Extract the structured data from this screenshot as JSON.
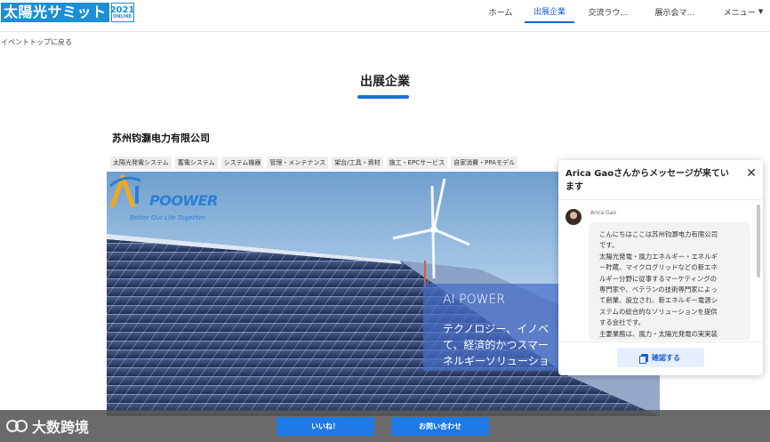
{
  "header": {
    "logo_text": "太陽光サミット",
    "logo_year": "2021",
    "logo_sub": "ONLINE",
    "nav": [
      "ホーム",
      "出展企業",
      "交流ラウ…",
      "展示会マ…"
    ],
    "menu_label": "メニュー"
  },
  "back_link": "イベントトップに戻る",
  "section_title": "出展企業",
  "company": {
    "name": "苏州钧灏电力有限公司",
    "tags": [
      "太陽光発電システム",
      "蓄電システム",
      "システム機器",
      "管理・メンテナンス",
      "架台/工具・資材",
      "施工・EPCサービス",
      "自家消費・PPAモデル"
    ]
  },
  "hero": {
    "brand_mark": "AI",
    "brand_name": "POOWER",
    "slogan": "Better Our Life Together",
    "overlay_title": "AI POWER",
    "overlay_lines": [
      "テクノロジー、イノベ",
      "て、経済的かつスマー",
      "ネルギーソリューショ"
    ]
  },
  "chat": {
    "title": "Arica Gaoさんからメッセージが来ています",
    "sender": "Arica Gao",
    "message_lines": [
      "こんにちはここは苏州钧灏电力有限公司",
      "です。",
      "太陽光発電・風力エネルギー・エネルギ",
      "ー貯蔵、マイクログリッドなどの新エネ",
      "ルギー分野に従事するマーケティングの",
      "専門家や、ベテランの技術専門家によっ",
      "て創業、設立され、新エネルギー電源シ",
      "ステムの総合的なソリューションを提供",
      "する会社です。",
      "主要業務は、風力・太陽光発電の実実装"
    ],
    "confirm_label": "確認する"
  },
  "bottom": {
    "like_label": "いいね！",
    "contact_label": "お問い合わせ",
    "watermark": "大数跨境"
  },
  "colors": {
    "brand_blue": "#1c8fd6",
    "accent_blue": "#1c5fd6",
    "button_blue": "#1e78e6"
  }
}
